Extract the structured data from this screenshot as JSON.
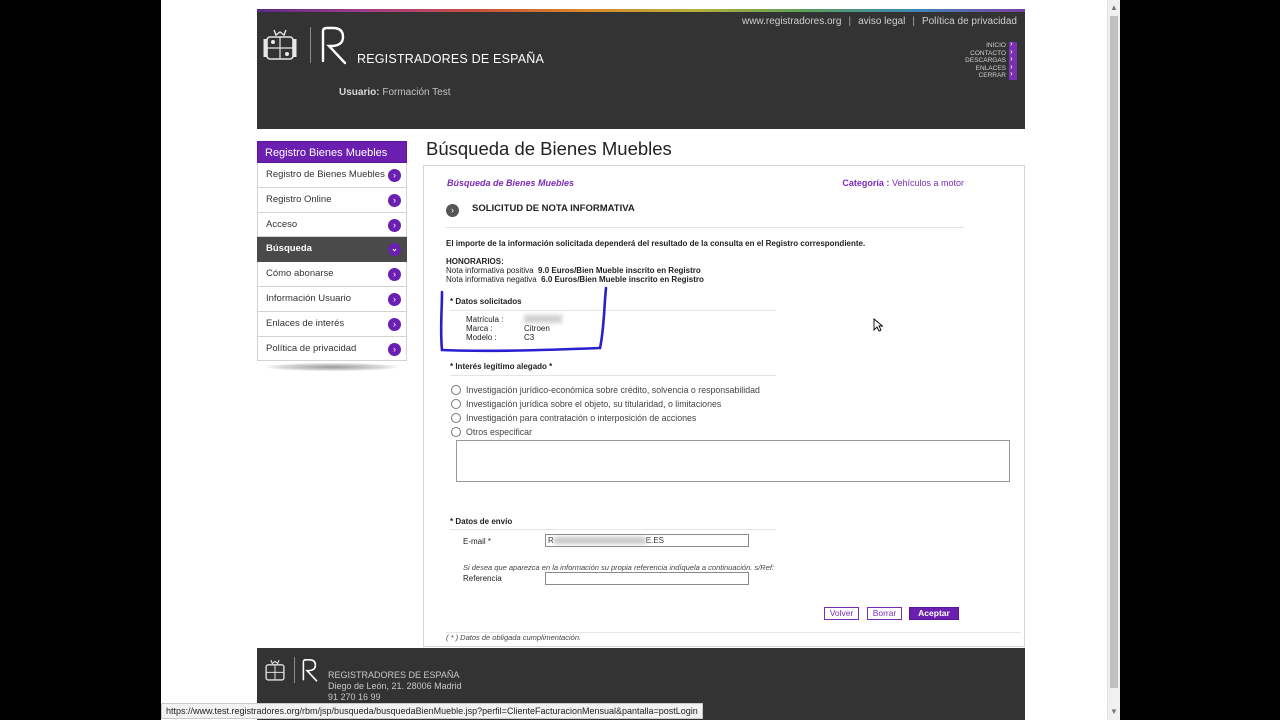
{
  "header": {
    "brand": "REGISTRADORES DE ESPAÑA",
    "top_links": [
      "www.registradores.org",
      "aviso legal",
      "Política de privacidad"
    ],
    "separator": "|",
    "side_menu": [
      "INICIO",
      "CONTACTO",
      "DESCARGAS",
      "ENLACES",
      "CERRAR"
    ],
    "usuario_label": "Usuario:",
    "usuario_value": "Formación Test"
  },
  "nav": {
    "title": "Registro Bienes Muebles",
    "items": [
      {
        "label": "Registro de Bienes Muebles",
        "icon": "chevron-right-icon"
      },
      {
        "label": "Registro Online",
        "icon": "chevron-right-icon"
      },
      {
        "label": "Acceso",
        "icon": "chevron-right-icon"
      },
      {
        "label": "Búsqueda",
        "icon": "chevron-down-icon"
      },
      {
        "label": "Cómo abonarse",
        "icon": "chevron-right-icon"
      },
      {
        "label": "Información Usuario",
        "icon": "chevron-right-icon"
      },
      {
        "label": "Enlaces de interés",
        "icon": "chevron-right-icon"
      },
      {
        "label": "Política de privacidad",
        "icon": "chevron-right-icon"
      }
    ],
    "active_index": 3
  },
  "main": {
    "title": "Búsqueda de Bienes Muebles",
    "crumb": "Búsqueda de Bienes Muebles",
    "categoria_label": "Categoría :",
    "categoria_value": "Vehículos a motor",
    "solicitud_title": "SOLICITUD DE NOTA INFORMATIVA",
    "importe_text": "El importe de la información solicitada dependerá del resultado de la consulta en el Registro correspondiente.",
    "honorarios_title": "HONORARIOS:",
    "honorarios_pos_label": "Nota informativa positiva",
    "honorarios_pos_value": "9.0 Euros/Bien Mueble inscrito en Registro",
    "honorarios_neg_label": "Nota informativa negativa",
    "honorarios_neg_value": "6.0 Euros/Bien Mueble inscrito en Registro",
    "datos_title": "* Datos solicitados",
    "matricula_label": "Matrícula :",
    "marca_label": "Marca :",
    "marca_value": "Citroen",
    "modelo_label": "Modelo :",
    "modelo_value": "C3",
    "interes_title": "* Interés legítimo alegado *",
    "interes_options": [
      "Investigación jurídico-económica sobre crédito, solvencia o responsabilidad",
      "Investigación jurídica sobre el objeto, su titularidad, o limitaciones",
      "Investigación para contratación o interposición de acciones",
      "Otros especificar"
    ],
    "envio_title": "* Datos de envío",
    "email_label": "E-mail *",
    "email_prefix": "R",
    "email_suffix": "E.ES",
    "ref_note": "Si desea que aparezca en la información su propia referencia indíquela a continuación. s/Ref:",
    "ref_label": "Referencia",
    "btn_volver": "Volver",
    "btn_borrar": "Borrar",
    "btn_aceptar": "Aceptar",
    "obligatoria": "( * ) Datos de obligada cumplimentación."
  },
  "footer": {
    "name": "REGISTRADORES DE ESPAÑA",
    "address": "Diego de León, 21. 28006 Madrid",
    "phone": "91 270 16 99"
  },
  "statusbar": {
    "url": "https://www.test.registradores.org/rbm/jsp/busqueda/busquedaBienMueble.jsp?perfil=ClienteFacturacionMensual&pantalla=postLogin"
  },
  "colors": {
    "accent": "#6b1fb1",
    "header_bg": "#333333",
    "annotation": "#2a1fd0"
  }
}
